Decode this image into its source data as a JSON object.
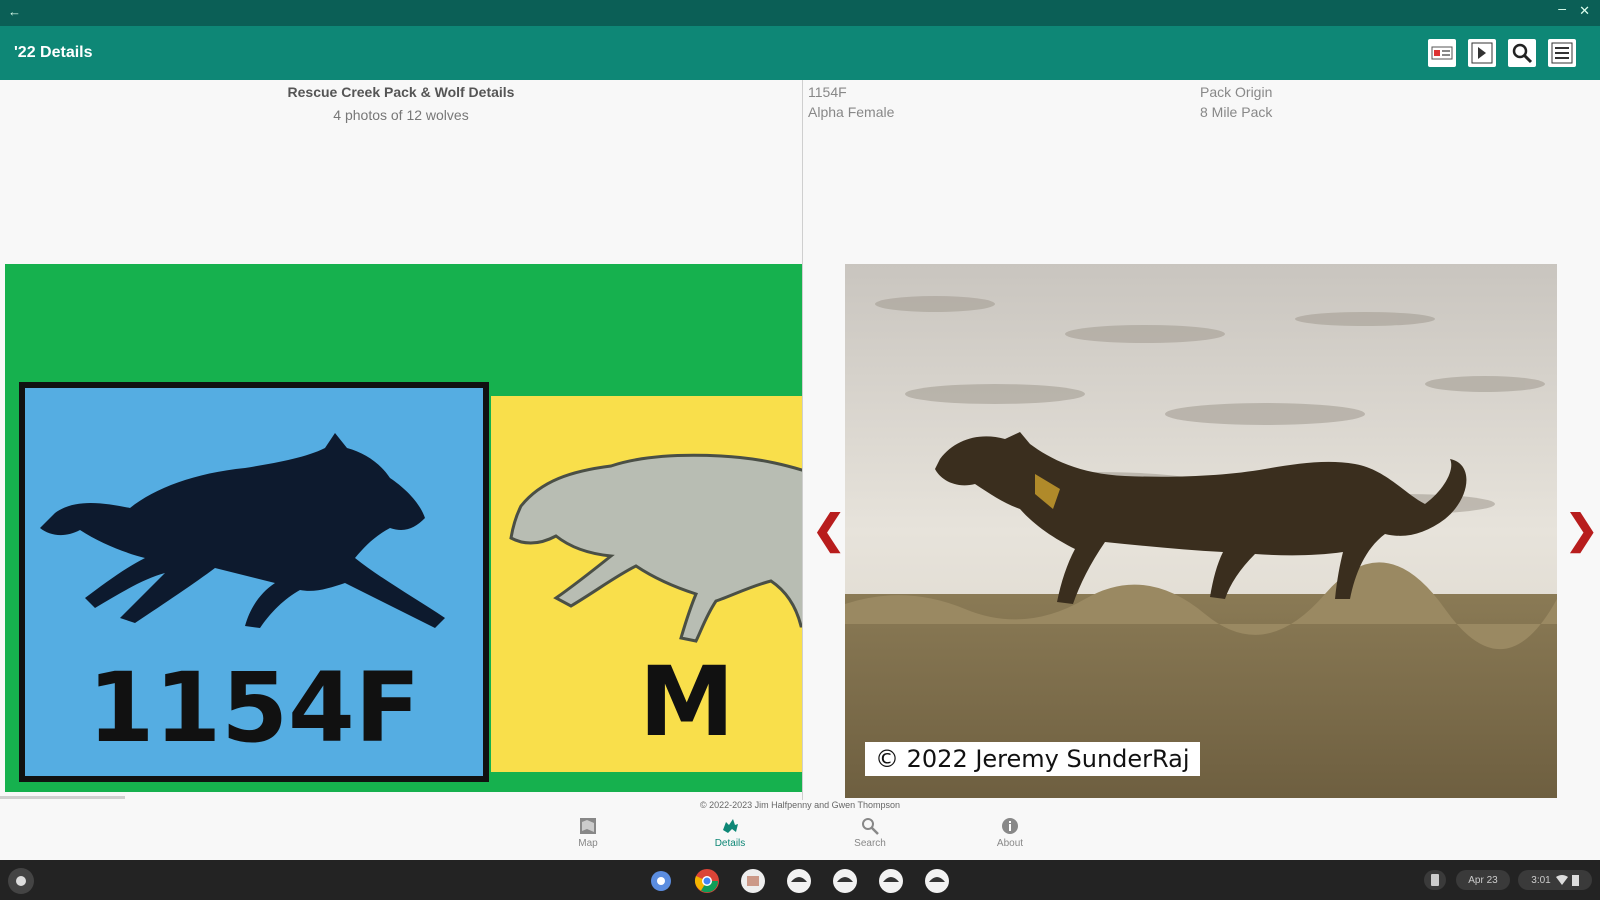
{
  "window": {
    "back_glyph": "←",
    "minimize_glyph": "–",
    "close_glyph": "✕"
  },
  "app_bar": {
    "title": "'22 Details"
  },
  "left_panel": {
    "heading": "Rescue Creek Pack & Wolf Details",
    "subheading": "4 photos of 12 wolves",
    "tiles": [
      {
        "label": "1154F",
        "color": "#55ade2"
      },
      {
        "label": "M",
        "color": "#f9df4b"
      }
    ],
    "background_color": "#16b14e"
  },
  "right_panel": {
    "wolf_id": "1154F",
    "wolf_role": "Alpha Female",
    "origin_label": "Pack Origin",
    "origin_value": "8 Mile Pack",
    "photo_credit": "© 2022 Jeremy SunderRaj",
    "prev_arrow": "❮",
    "next_arrow": "❯"
  },
  "footer": {
    "copyright": "© 2022-2023 Jim Halfpenny and Gwen Thompson"
  },
  "bottom_nav": [
    {
      "label": "Map",
      "icon": "map-icon",
      "active": false
    },
    {
      "label": "Details",
      "icon": "wolf-icon",
      "active": true
    },
    {
      "label": "Search",
      "icon": "search-icon",
      "active": false
    },
    {
      "label": "About",
      "icon": "info-icon",
      "active": false
    }
  ],
  "taskbar": {
    "date": "Apr 23",
    "time": "3:01"
  },
  "colors": {
    "primary": "#0e8776",
    "titlebar": "#0b5f56",
    "arrow": "#b81d1d"
  }
}
